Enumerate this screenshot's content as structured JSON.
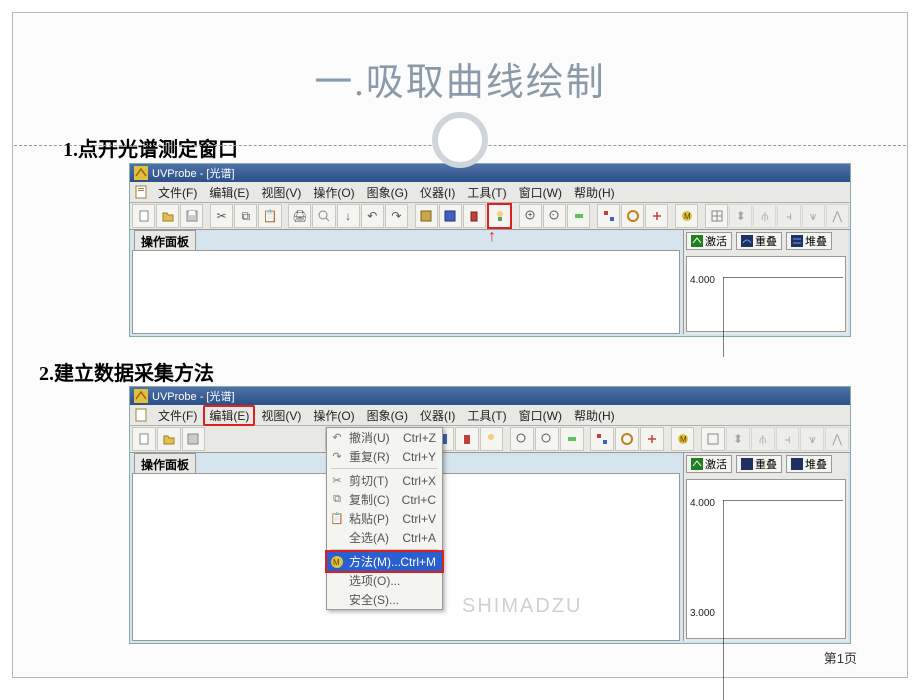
{
  "slide": {
    "title": "一.吸取曲线绘制",
    "footer": "第1页",
    "watermark": "SHIMADZU"
  },
  "step1": {
    "label": "1.点开光谱测定窗口",
    "win_title": "UVProbe - [光谱]",
    "panel_label": "操作面板",
    "arrow_char": "↑",
    "y_tick": "4.000"
  },
  "step2": {
    "label": "2.建立数据采集方法",
    "y_tick1": "4.000",
    "y_tick2": "3.000"
  },
  "menus": {
    "items": [
      {
        "label": "文件(F)"
      },
      {
        "label": "编辑(E)"
      },
      {
        "label": "视图(V)"
      },
      {
        "label": "操作(O)"
      },
      {
        "label": "图象(G)"
      },
      {
        "label": "仪器(I)"
      },
      {
        "label": "工具(T)"
      },
      {
        "label": "窗口(W)"
      },
      {
        "label": "帮助(H)"
      }
    ]
  },
  "right_buttons": {
    "b1": "激活",
    "b2": "重叠",
    "b3": "堆叠"
  },
  "dropdown": {
    "items": [
      {
        "icon": "↶",
        "label": "撤消(U)",
        "shortcut": "Ctrl+Z"
      },
      {
        "icon": "↷",
        "label": "重复(R)",
        "shortcut": "Ctrl+Y"
      },
      {
        "sep": true
      },
      {
        "icon": "✂",
        "label": "剪切(T)",
        "shortcut": "Ctrl+X"
      },
      {
        "icon": "⧉",
        "label": "复制(C)",
        "shortcut": "Ctrl+C"
      },
      {
        "icon": "📋",
        "label": "粘贴(P)",
        "shortcut": "Ctrl+V"
      },
      {
        "icon": "",
        "label": "全选(A)",
        "shortcut": "Ctrl+A"
      },
      {
        "sep": true
      },
      {
        "icon": "M",
        "label": "方法(M)...",
        "shortcut": "Ctrl+M",
        "hi": true
      },
      {
        "icon": "",
        "label": "选项(O)...",
        "shortcut": ""
      },
      {
        "icon": "",
        "label": "安全(S)...",
        "shortcut": ""
      }
    ]
  }
}
